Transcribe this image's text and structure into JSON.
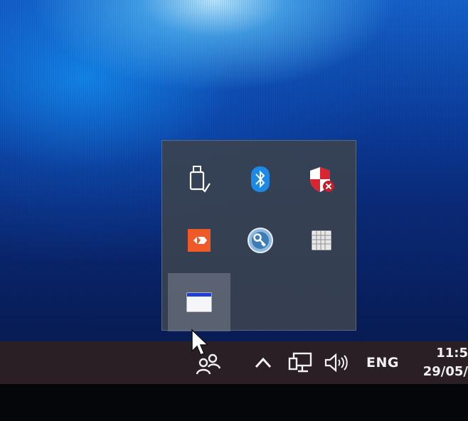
{
  "tray_overflow": {
    "icons": [
      {
        "name": "usb-safely-remove-icon"
      },
      {
        "name": "bluetooth-icon"
      },
      {
        "name": "security-shield-warning-icon"
      },
      {
        "name": "orange-app-icon"
      },
      {
        "name": "key-app-icon"
      },
      {
        "name": "grid-app-icon"
      },
      {
        "name": "window-app-icon"
      }
    ]
  },
  "taskbar": {
    "people_icon": "people-icon",
    "show_hidden_icon": "chevron-up-icon",
    "network_icon": "network-icon",
    "volume_icon": "speaker-icon",
    "language": "ENG",
    "time": "11:5",
    "date": "29/05/"
  },
  "colors": {
    "taskbar_bg": "#2a1f24",
    "flyout_bg": "#3a4250",
    "bluetooth_blue": "#1e88e5",
    "orange_app": "#f05a28",
    "shield_red": "#d9252f"
  }
}
